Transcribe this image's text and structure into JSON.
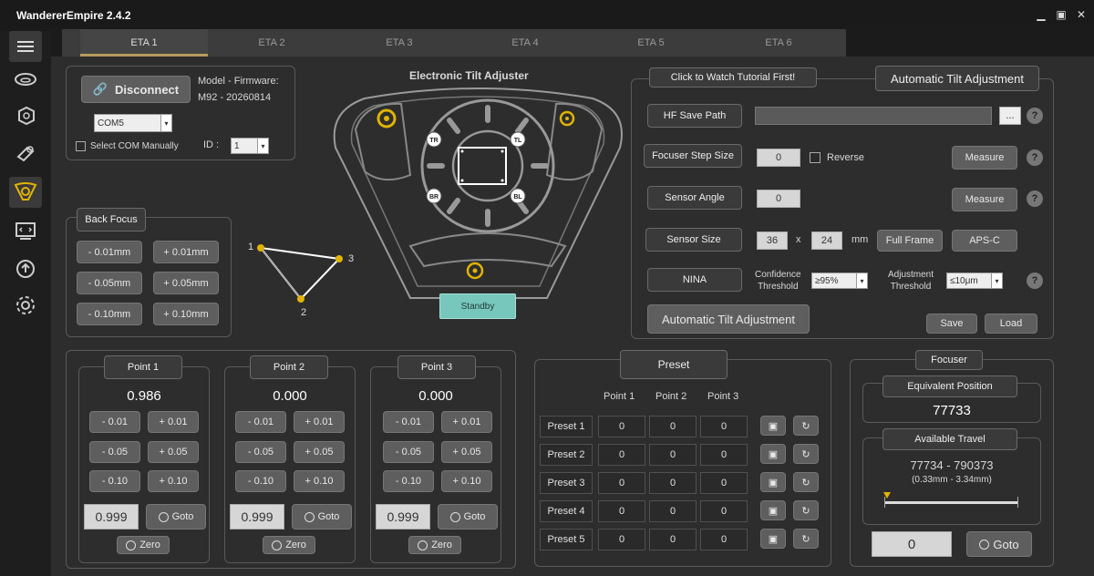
{
  "app": {
    "title": "WandererEmpire 2.4.2"
  },
  "tabs": [
    "ETA 1",
    "ETA 2",
    "ETA 3",
    "ETA 4",
    "ETA 5",
    "ETA 6"
  ],
  "connection": {
    "disconnect_label": "Disconnect",
    "model_label": "Model - Firmware:",
    "model_value": "M92 - 20260814",
    "com_port": "COM5",
    "select_com_label": "Select COM Manually",
    "id_label": "ID :",
    "id_value": "1"
  },
  "diagram": {
    "title": "Electronic Tilt Adjuster",
    "labels": {
      "tr": "TR",
      "tl": "TL",
      "br": "BR",
      "bl": "BL"
    },
    "status": "Standby"
  },
  "back_focus": {
    "title": "Back Focus",
    "buttons": [
      "- 0.01mm",
      "+ 0.01mm",
      "- 0.05mm",
      "+ 0.05mm",
      "- 0.10mm",
      "+ 0.10mm"
    ]
  },
  "triangle": {
    "p1": "1",
    "p2": "2",
    "p3": "3"
  },
  "tilt": {
    "tutorial_label": "Click to Watch Tutorial First!",
    "auto_title": "Automatic Tilt Adjustment",
    "hf_save_label": "HF Save Path",
    "browse_label": "...",
    "focuser_step_label": "Focuser Step Size",
    "focuser_step_value": "0",
    "reverse_label": "Reverse",
    "measure_label": "Measure",
    "sensor_angle_label": "Sensor Angle",
    "sensor_angle_value": "0",
    "sensor_size_label": "Sensor Size",
    "sensor_w": "36",
    "sensor_x": "x",
    "sensor_h": "24",
    "sensor_unit": "mm",
    "full_frame_label": "Full Frame",
    "apsc_label": "APS-C",
    "nina_label": "NINA",
    "confidence_label": "Confidence\nThreshold",
    "confidence_value": "≥95%",
    "adjustment_label": "Adjustment\nThreshold",
    "adjustment_value": "≤10μm",
    "auto_button": "Automatic Tilt Adjustment",
    "save_label": "Save",
    "load_label": "Load",
    "help": "?"
  },
  "points": [
    {
      "title": "Point 1",
      "value": "0.986",
      "buttons": [
        "- 0.01",
        "+ 0.01",
        "- 0.05",
        "+ 0.05",
        "- 0.10",
        "+ 0.10"
      ],
      "input": "0.999",
      "goto": "Goto",
      "zero": "Zero"
    },
    {
      "title": "Point 2",
      "value": "0.000",
      "buttons": [
        "- 0.01",
        "+ 0.01",
        "- 0.05",
        "+ 0.05",
        "- 0.10",
        "+ 0.10"
      ],
      "input": "0.999",
      "goto": "Goto",
      "zero": "Zero"
    },
    {
      "title": "Point 3",
      "value": "0.000",
      "buttons": [
        "- 0.01",
        "+ 0.01",
        "- 0.05",
        "+ 0.05",
        "- 0.10",
        "+ 0.10"
      ],
      "input": "0.999",
      "goto": "Goto",
      "zero": "Zero"
    }
  ],
  "preset": {
    "title": "Preset",
    "headers": [
      "Point 1",
      "Point 2",
      "Point 3"
    ],
    "rows": [
      {
        "label": "Preset 1",
        "values": [
          "0",
          "0",
          "0"
        ]
      },
      {
        "label": "Preset 2",
        "values": [
          "0",
          "0",
          "0"
        ]
      },
      {
        "label": "Preset 3",
        "values": [
          "0",
          "0",
          "0"
        ]
      },
      {
        "label": "Preset 4",
        "values": [
          "0",
          "0",
          "0"
        ]
      },
      {
        "label": "Preset 5",
        "values": [
          "0",
          "0",
          "0"
        ]
      }
    ]
  },
  "focuser": {
    "title": "Focuser",
    "equiv_label": "Equivalent Position",
    "equiv_value": "77733",
    "travel_label": "Available Travel",
    "travel_value": "77734 - 790373",
    "travel_mm": "(0.33mm - 3.34mm)",
    "travel_fraction": 0.02,
    "input": "0",
    "goto": "Goto"
  },
  "colors": {
    "accent": "#e0b400",
    "teal": "#78c7bd",
    "panel": "#2d2d2d"
  }
}
